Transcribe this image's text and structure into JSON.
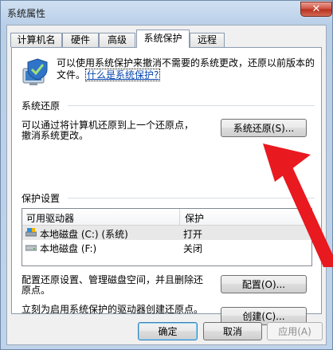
{
  "window": {
    "title": "系统属性",
    "close_glyph": "✕"
  },
  "tabs": [
    {
      "label": "计算机名"
    },
    {
      "label": "硬件"
    },
    {
      "label": "高级"
    },
    {
      "label": "系统保护",
      "active": true
    },
    {
      "label": "远程"
    }
  ],
  "intro": {
    "text": "可以使用系统保护来撤消不需要的系统更改，还原以前版本的文件。",
    "link": "什么是系统保护?"
  },
  "restore": {
    "group_title": "系统还原",
    "line1": "可以通过将计算机还原到上一个还原点，",
    "line2": "撤消系统更改。",
    "button": "系统还原(S)..."
  },
  "protection": {
    "group_title": "保护设置",
    "columns": [
      "可用驱动器",
      "保护"
    ],
    "rows": [
      {
        "drive": "本地磁盘 (C:) (系统)",
        "status": "打开"
      },
      {
        "drive": "本地磁盘 (F:)",
        "status": "关闭"
      }
    ],
    "configure_text_1": "配置还原设置、管理磁盘空间，并且删除还",
    "configure_text_2": "原点。",
    "configure_button": "配置(O)...",
    "create_text": "立刻为启用系统保护的驱动器创建还原点。",
    "create_button": "创建(C)..."
  },
  "footer": {
    "ok": "确定",
    "cancel": "取消",
    "apply": "应用(A)"
  },
  "colors": {
    "annotation_arrow": "#e8191f",
    "link": "#0645ad",
    "selected_row": "#e8e8e8"
  }
}
